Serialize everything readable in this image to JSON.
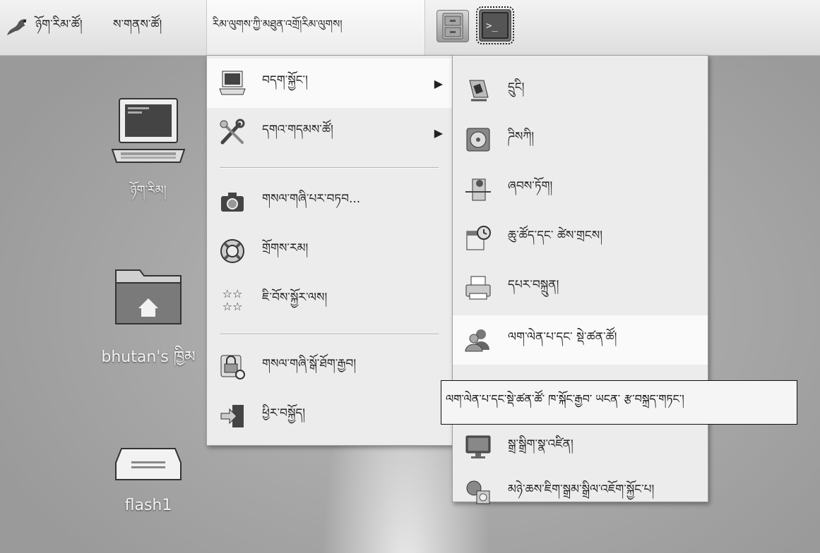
{
  "panel": {
    "applications_label": "ཉོག་རིམ་ཚོ།",
    "places_label": "ས་གནས་ཚོ།",
    "system_label": "རིམ་ལུགས་ཀྱི་མཐུན་འགྲོ།རིམ་ལུགས།",
    "launchers": [
      {
        "icon": "file-cabinet-icon"
      },
      {
        "icon": "terminal-icon"
      }
    ]
  },
  "desktop": {
    "icons": [
      {
        "icon": "computer-icon",
        "label": "ཉོག་རིམ།"
      },
      {
        "icon": "home-folder-icon",
        "label": "bhutan's ཁྱིམ"
      },
      {
        "icon": "drive-icon",
        "label": "flash1"
      }
    ]
  },
  "system_menu": {
    "items": [
      {
        "icon": "computer-icon",
        "label": "བདག་སྐྱོང་།",
        "submenu": true
      },
      {
        "icon": "tools-icon",
        "label": "དགའ་གདམས་ཚོ།",
        "submenu": true
      },
      {
        "icon": "camera-icon",
        "label": "གསལ་གཞི་པར་བཏབ...",
        "submenu": false
      },
      {
        "icon": "lifebuoy-icon",
        "label": "གྲོགས་རམ།",
        "submenu": false
      },
      {
        "icon": "about-icon",
        "label": "ཇི་བོས་སྐྱོར་ལས།",
        "submenu": false
      },
      {
        "icon": "lock-screen-icon",
        "label": "གསལ་གཞི་སྒོ་ཐོག་རྒྱབ།",
        "submenu": false
      },
      {
        "icon": "logout-icon",
        "label": "ཕྱིར་བསྐྱོད།",
        "submenu": false
      }
    ]
  },
  "admin_submenu": {
    "items": [
      {
        "icon": "power-switch-icon",
        "label": "དྲུངི།"
      },
      {
        "icon": "disk-icon",
        "label": "ཌིསཀི།"
      },
      {
        "icon": "network-door-icon",
        "label": "ཞབས་ཏོག།"
      },
      {
        "icon": "calendar-clock-icon",
        "label": "ཆུ་ཚོད་དང་ ཚེས་གྲངས།"
      },
      {
        "icon": "printer-icon",
        "label": "དཔར་བསྐྲུན།"
      },
      {
        "icon": "users-groups-icon",
        "label": "ལག་ལེན་པ་དང་ སྡེ་ཚན་ཚོ།"
      },
      {
        "icon": "monitor-icon",
        "label": "སྒྲ་སྒྲིག་སྣ་འཛིན།"
      },
      {
        "icon": "software-install-icon",
        "label": "མཉེ་ཆས་ཇིག་སྒྲམ་སྒྲིལ་འཇོག་སྐྱོང་པ།"
      }
    ]
  },
  "tooltip": {
    "text": "ལག་ལེན་པ་དང་སྡེ་ཚན་ཚོ་ ཁ་སྐོང་རྒྱབ་ ཡངན་ རྩ་བསྐྲད་གཏང་།"
  }
}
